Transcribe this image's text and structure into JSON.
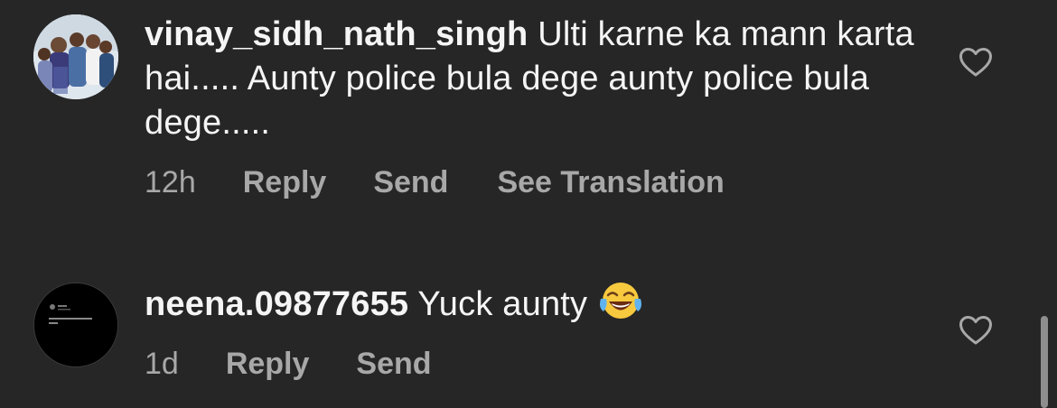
{
  "comments": [
    {
      "username": "vinay_sidh_nath_singh",
      "text": "Ulti karne ka mann karta hai..... Aunty police bula dege aunty police bula dege.....",
      "time": "12h",
      "reply_label": "Reply",
      "send_label": "Send",
      "translate_label": "See Translation"
    },
    {
      "username": "neena.09877655",
      "text": "Yuck aunty",
      "emoji": "face-with-tears-of-joy",
      "time": "1d",
      "reply_label": "Reply",
      "send_label": "Send"
    }
  ],
  "colors": {
    "background": "#262626",
    "primary_text": "#f5f5f5",
    "secondary_text": "#a8a8a8"
  },
  "icons": {
    "like": "heart-outline-icon"
  }
}
